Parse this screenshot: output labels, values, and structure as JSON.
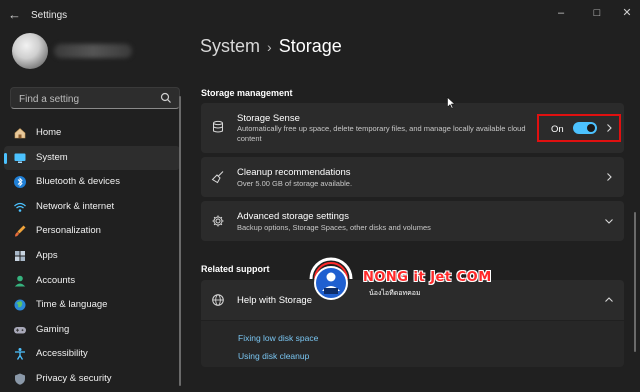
{
  "window": {
    "title": "Settings",
    "controls": [
      "minimize",
      "maximize",
      "close"
    ]
  },
  "user": {
    "avatar_icon": "user-avatar",
    "name_hidden": true
  },
  "search": {
    "placeholder": "Find a setting",
    "icon": "search-icon"
  },
  "nav": {
    "items": [
      {
        "label": "Home",
        "icon": "home-icon",
        "active": false
      },
      {
        "label": "System",
        "icon": "monitor-icon",
        "active": true
      },
      {
        "label": "Bluetooth & devices",
        "icon": "bluetooth-icon",
        "active": false
      },
      {
        "label": "Network & internet",
        "icon": "wifi-icon",
        "active": false
      },
      {
        "label": "Personalization",
        "icon": "brush-icon",
        "active": false
      },
      {
        "label": "Apps",
        "icon": "apps-icon",
        "active": false
      },
      {
        "label": "Accounts",
        "icon": "person-icon",
        "active": false
      },
      {
        "label": "Time & language",
        "icon": "globe-icon",
        "active": false
      },
      {
        "label": "Gaming",
        "icon": "gamepad-icon",
        "active": false
      },
      {
        "label": "Accessibility",
        "icon": "accessibility-icon",
        "active": false
      },
      {
        "label": "Privacy & security",
        "icon": "shield-icon",
        "active": false
      }
    ]
  },
  "breadcrumb": {
    "parent": "System",
    "separator": "›",
    "current": "Storage"
  },
  "storage_management": {
    "title": "Storage management",
    "storage_sense": {
      "title": "Storage Sense",
      "description": "Automatically free up space, delete temporary files, and manage locally available cloud content",
      "toggle_label": "On",
      "toggle_on": true,
      "highlight_color": "#e01010"
    },
    "cleanup": {
      "title": "Cleanup recommendations",
      "description": "Over 5.00 GB of storage available."
    },
    "advanced": {
      "title": "Advanced storage settings",
      "description": "Backup options, Storage Spaces, other disks and volumes"
    }
  },
  "related_support": {
    "title": "Related support",
    "help": {
      "title": "Help with Storage",
      "links": [
        "Fixing low disk space",
        "Using disk cleanup"
      ]
    }
  },
  "watermark": {
    "text": "NONG it Jet COM",
    "subtext": "น้องไอทีดอทคอม"
  },
  "colors": {
    "accent": "#4cc2ff",
    "background": "#202020",
    "card": "#2b2b2b",
    "link": "#7ac6f2"
  }
}
